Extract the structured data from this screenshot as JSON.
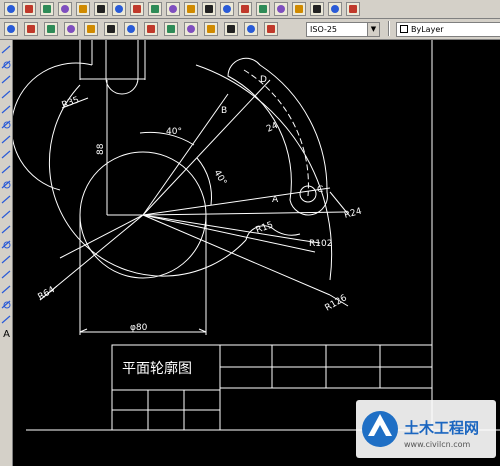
{
  "toolbar": {
    "dimstyle_value": "ISO-25",
    "layer_value": "ByLayer",
    "row1_icons": [
      "new-icon",
      "open-icon",
      "save-icon",
      "print-icon",
      "preview-icon",
      "publish-icon",
      "cut-icon",
      "copy-icon",
      "paste-icon",
      "matchprop-icon",
      "undo-icon",
      "redo-icon",
      "pan-icon",
      "zoom-realtime-icon",
      "zoom-window-icon",
      "zoom-previous-icon",
      "properties-icon",
      "designcenter-icon",
      "toolpalette-icon",
      "help-icon"
    ],
    "row2_icons": [
      "linear-dim-icon",
      "aligned-dim-icon",
      "ordinate-dim-icon",
      "radius-dim-icon",
      "diameter-dim-icon",
      "angular-dim-icon",
      "baseline-dim-icon",
      "continue-dim-icon",
      "leader-icon",
      "tolerance-icon",
      "center-mark-icon",
      "dimedit-icon",
      "dimtedit-icon",
      "dimupdate-icon"
    ]
  },
  "palette": {
    "icons": [
      "line-icon",
      "construction-line-icon",
      "polyline-icon",
      "polygon-icon",
      "rectangle-icon",
      "arc-icon",
      "circle-icon",
      "revcloud-icon",
      "spline-icon",
      "ellipse-icon",
      "ellipse-arc-icon",
      "insert-block-icon",
      "make-block-icon",
      "point-icon",
      "hatch-icon",
      "gradient-icon",
      "region-icon",
      "table-icon",
      "mtext-icon"
    ],
    "text_tool_label": "A"
  },
  "drawing": {
    "dimensions": {
      "r35": "R35",
      "d88": "88",
      "a40_top": "40°",
      "a40_mid": "40°",
      "d24": "24",
      "r24": "R24",
      "r15": "R15",
      "r102": "R102",
      "r64": "R64",
      "r126": "R126",
      "phi80": "φ80"
    },
    "points": {
      "a": "A",
      "b": "B",
      "c": "C",
      "d": "D"
    },
    "title_block": {
      "title": "平面轮廓图"
    }
  },
  "watermark": {
    "brand": "土木工程网",
    "url": "www.civilcn.com"
  }
}
